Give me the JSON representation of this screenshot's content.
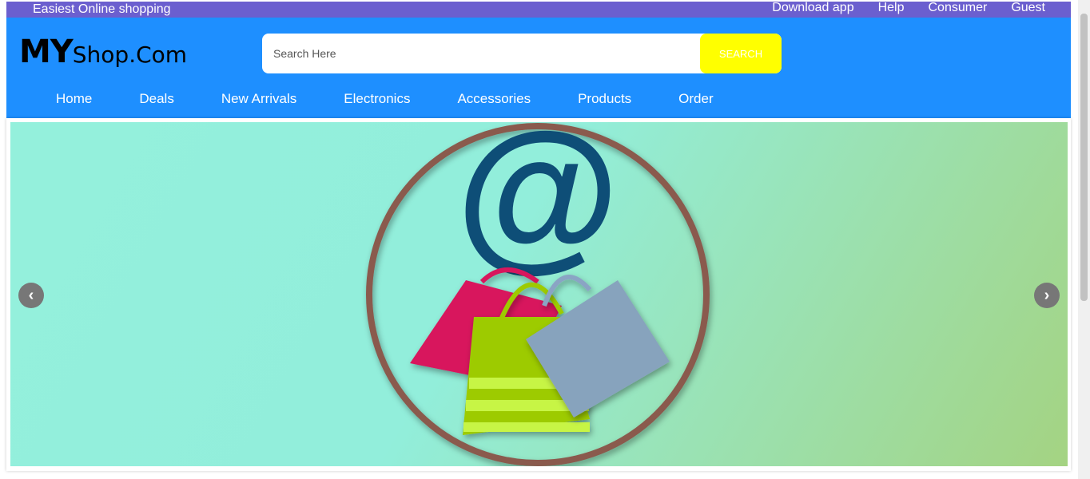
{
  "topbar": {
    "tagline": "Easiest Online shopping",
    "links": [
      "Download app",
      "Help",
      "Consumer",
      "Guest"
    ]
  },
  "logo": {
    "part1": "MY",
    "part2": "Shop.Com"
  },
  "search": {
    "placeholder": "Search Here",
    "value": "",
    "button_label": "SEARCH"
  },
  "nav": [
    "Home",
    "Deals",
    "New Arrivals",
    "Electronics",
    "Accessories",
    "Products",
    "Order"
  ],
  "carousel": {
    "prev_icon": "chevron-left-icon",
    "next_icon": "chevron-right-icon",
    "image": "shopping-bags-at-sign-illustration"
  },
  "colors": {
    "topbar": "#6b5fcf",
    "header": "#1e8fff",
    "search_button": "#ffff00"
  }
}
